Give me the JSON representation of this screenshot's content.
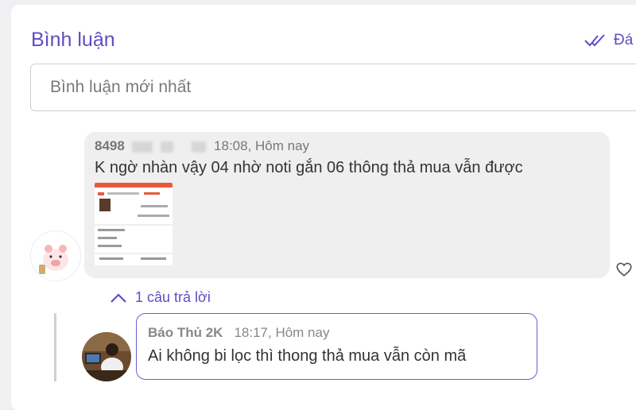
{
  "header": {
    "title": "Bình luận",
    "mark_read_label": "Đá"
  },
  "sort": {
    "placeholder": "Bình luận mới nhất"
  },
  "comment": {
    "username": "8498",
    "time": "18:08, Hôm nay",
    "text": "K ngờ nhàn vậy 04 nhờ noti gắn 06 thông thả mua vẫn được"
  },
  "replies_toggle": {
    "label": "1 câu trả lời"
  },
  "reply": {
    "username": "Báo Thủ 2K",
    "time": "18:17, Hôm nay",
    "text": "Ai không bi lọc thì thong thả mua vẫn còn mã"
  },
  "colors": {
    "accent": "#5d4ec4",
    "bubble_bg": "#efefef",
    "reply_border": "#6b5dd3"
  },
  "icons": {
    "mark_read": "double-check-icon",
    "like": "heart-icon",
    "toggle": "chevron-up-icon"
  }
}
